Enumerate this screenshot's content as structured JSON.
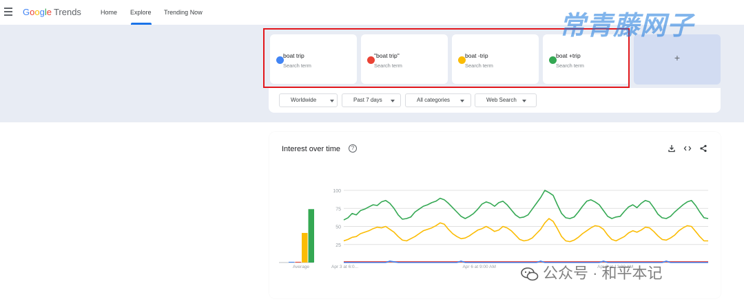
{
  "header": {
    "logo_google": [
      "G",
      "o",
      "o",
      "g",
      "l",
      "e"
    ],
    "logo_product": "Trends",
    "nav": [
      {
        "label": "Home"
      },
      {
        "label": "Explore",
        "active": true
      },
      {
        "label": "Trending Now"
      }
    ]
  },
  "terms": [
    {
      "name": "boat trip",
      "sub": "Search term",
      "color": "#4285f4"
    },
    {
      "name": "\"boat trip\"",
      "sub": "Search term",
      "color": "#ea4335"
    },
    {
      "name": "boat -trip",
      "sub": "Search term",
      "color": "#fbbc04"
    },
    {
      "name": "boat +trip",
      "sub": "Search term",
      "color": "#34a853"
    }
  ],
  "add_label": "+",
  "filters": [
    {
      "label": "Worldwide"
    },
    {
      "label": "Past 7 days"
    },
    {
      "label": "All categories"
    },
    {
      "label": "Web Search"
    }
  ],
  "chart": {
    "title": "Interest over time",
    "help": "?",
    "actions": {
      "download": "download-icon",
      "embed": "embed-icon",
      "share": "share-icon"
    }
  },
  "watermarks": {
    "top": "常青藤网子",
    "bottom": "公众号 · 和平本记"
  },
  "chart_data": {
    "type": "line",
    "title": "Interest over time",
    "ylim": [
      0,
      100
    ],
    "yticks": [
      25,
      50,
      75,
      100
    ],
    "x_tick_labels": [
      "Apr 3 at 6:0...",
      "Apr 6 at 9:00 AM",
      "Apr 9 at 12:00 AM"
    ],
    "x_tick_positions": [
      0,
      0.36,
      0.73
    ],
    "grid": true,
    "average_bars": {
      "label": "Average",
      "values": [
        1,
        1,
        41,
        74
      ],
      "colors": [
        "#4285f4",
        "#ea4335",
        "#fbbc04",
        "#34a853"
      ]
    },
    "series": [
      {
        "term_index": 3,
        "color": "#34a853",
        "values": [
          59,
          62,
          68,
          66,
          72,
          74,
          77,
          80,
          79,
          84,
          86,
          82,
          75,
          66,
          60,
          61,
          63,
          70,
          74,
          78,
          80,
          83,
          85,
          89,
          87,
          82,
          76,
          70,
          64,
          61,
          64,
          68,
          74,
          81,
          84,
          82,
          78,
          83,
          85,
          80,
          73,
          66,
          62,
          63,
          66,
          74,
          82,
          90,
          100,
          97,
          93,
          80,
          68,
          62,
          61,
          63,
          70,
          78,
          85,
          87,
          84,
          80,
          72,
          64,
          61,
          63,
          64,
          71,
          77,
          80,
          76,
          82,
          86,
          84,
          76,
          67,
          62,
          61,
          64,
          70,
          75,
          80,
          84,
          86,
          79,
          70,
          62,
          61
        ]
      },
      {
        "term_index": 2,
        "color": "#fbbc04",
        "values": [
          30,
          32,
          35,
          36,
          40,
          42,
          44,
          47,
          49,
          48,
          50,
          46,
          42,
          36,
          31,
          30,
          33,
          36,
          40,
          44,
          46,
          48,
          51,
          55,
          53,
          46,
          40,
          36,
          33,
          34,
          37,
          41,
          45,
          47,
          50,
          47,
          43,
          45,
          50,
          48,
          44,
          38,
          32,
          30,
          31,
          34,
          40,
          46,
          55,
          61,
          57,
          47,
          36,
          30,
          29,
          31,
          35,
          40,
          44,
          48,
          51,
          50,
          46,
          38,
          32,
          30,
          33,
          36,
          41,
          44,
          42,
          45,
          49,
          48,
          43,
          37,
          32,
          31,
          34,
          38,
          44,
          48,
          51,
          50,
          43,
          36,
          30,
          30
        ]
      },
      {
        "term_index": 1,
        "color": "#ea4335",
        "values": [
          1,
          1,
          1,
          1,
          1,
          1,
          1,
          1,
          1,
          1,
          1,
          1,
          1,
          1,
          1,
          1,
          1,
          1,
          1,
          1,
          1,
          1,
          1,
          1,
          1,
          1,
          1,
          1,
          1,
          1,
          1,
          1,
          1,
          1,
          1,
          1,
          1,
          1,
          1,
          1,
          1,
          1,
          1,
          1,
          1,
          1,
          1,
          1,
          1,
          1,
          1,
          1,
          1,
          1,
          1,
          1,
          1,
          1,
          1,
          1,
          1,
          1,
          1,
          1,
          1,
          1,
          1,
          1,
          1,
          1,
          1,
          1,
          1,
          1,
          1,
          1,
          1,
          1,
          1,
          1,
          1,
          1,
          1,
          1,
          1,
          1,
          1,
          1
        ]
      },
      {
        "term_index": 0,
        "color": "#4285f4",
        "values": [
          0,
          0,
          0,
          0,
          0,
          0,
          0,
          0,
          0,
          0,
          0,
          2,
          1,
          0,
          0,
          0,
          0,
          0,
          0,
          0,
          0,
          0,
          0,
          0,
          0,
          0,
          0,
          0,
          2,
          0,
          0,
          0,
          0,
          0,
          0,
          0,
          0,
          0,
          0,
          0,
          0,
          0,
          0,
          0,
          0,
          0,
          0,
          2,
          0,
          0,
          0,
          0,
          0,
          0,
          0,
          0,
          0,
          0,
          0,
          0,
          0,
          0,
          2,
          0,
          0,
          0,
          0,
          0,
          0,
          0,
          0,
          0,
          0,
          0,
          0,
          0,
          0,
          2,
          0,
          0,
          0,
          0,
          0,
          0,
          0,
          0,
          0,
          0
        ]
      }
    ]
  }
}
